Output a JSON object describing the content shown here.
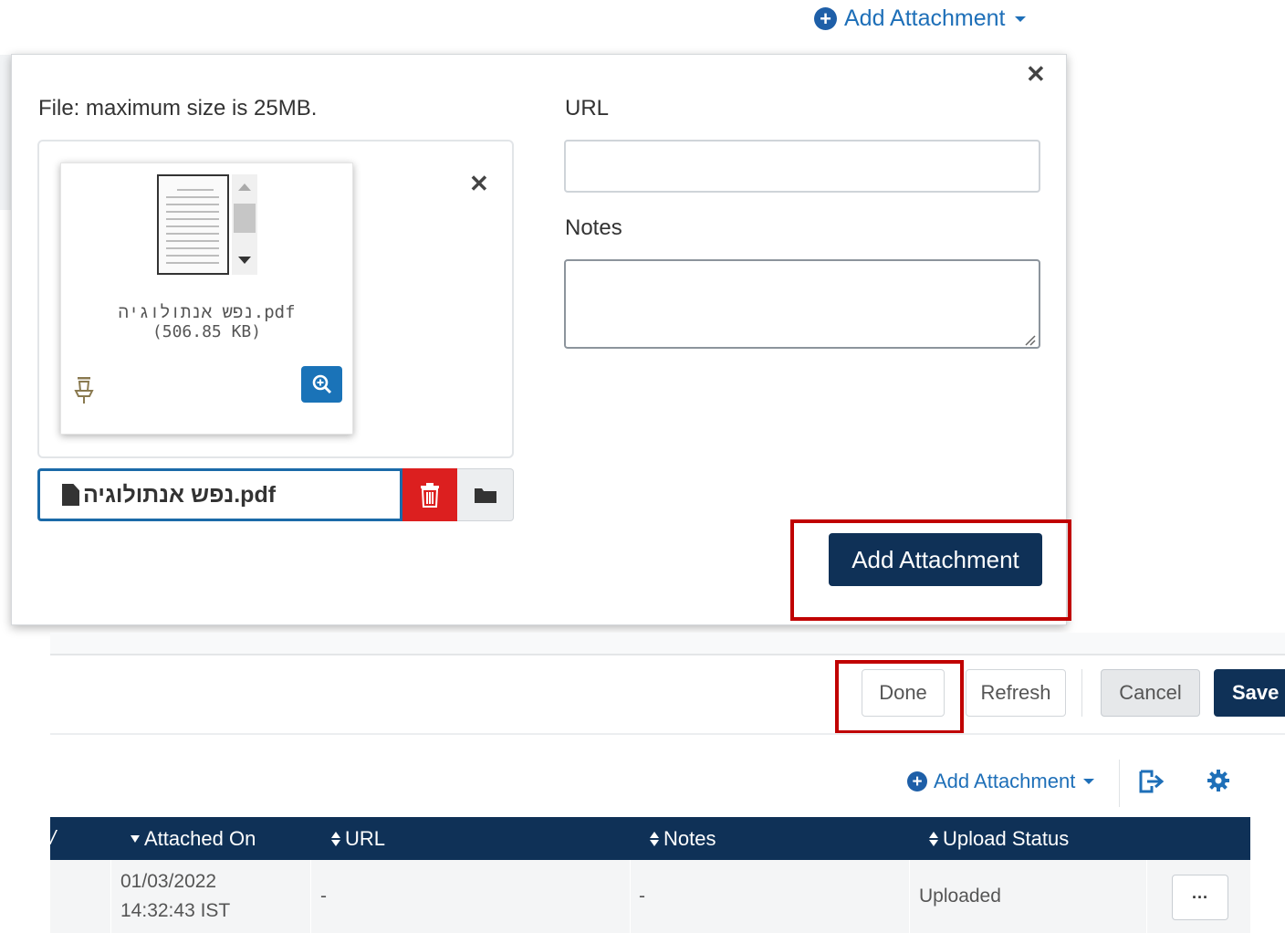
{
  "top_link": {
    "label": "Add Attachment"
  },
  "popup": {
    "file_hint": "File: maximum size is 25MB.",
    "url_label": "URL",
    "url_value": "",
    "notes_label": "Notes",
    "notes_value": "",
    "preview": {
      "file_name": "נפש אנתולוגיה.pdf",
      "file_size": "(506.85 KB)"
    },
    "selected_file": "נפש אנתולוגיה.pdf",
    "submit_label": "Add Attachment"
  },
  "toolbar": {
    "done_label": "Done",
    "refresh_label": "Refresh",
    "cancel_label": "Cancel",
    "save_label": "Save"
  },
  "table_toolbar": {
    "add_label": "Add Attachment"
  },
  "table": {
    "headers": {
      "attached_on": "Attached On",
      "url": "URL",
      "notes": "Notes",
      "upload_status": "Upload Status"
    },
    "rows": [
      {
        "date": "01/03/2022",
        "time": "14:32:43 IST",
        "url": "-",
        "notes": "-",
        "status": "Uploaded",
        "more": "···"
      }
    ]
  },
  "colors": {
    "primary_navy": "#0f3157",
    "link_blue": "#1e6fb8",
    "highlight_red": "#c00000",
    "delete_red": "#dc1f1f"
  }
}
